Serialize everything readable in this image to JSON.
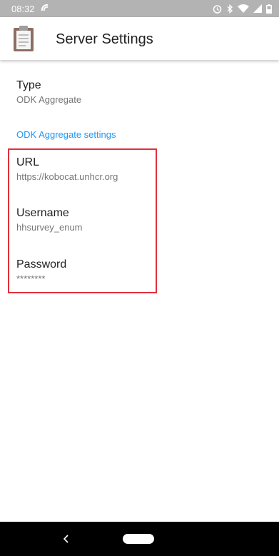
{
  "status_bar": {
    "time": "08:32"
  },
  "app_bar": {
    "title": "Server Settings"
  },
  "preferences": {
    "type": {
      "title": "Type",
      "summary": "ODK Aggregate"
    },
    "category": "ODK Aggregate settings",
    "url": {
      "title": "URL",
      "summary": "https://kobocat.unhcr.org"
    },
    "username": {
      "title": "Username",
      "summary": "hhsurvey_enum"
    },
    "password": {
      "title": "Password",
      "summary": "********"
    }
  },
  "colors": {
    "accent": "#2196f3",
    "highlight": "#e0303a",
    "status_bar": "#b3b3b3",
    "nav_bar": "#000000"
  },
  "icons": {
    "app": "clipboard-icon",
    "status": [
      "sync-icon",
      "alarm-icon",
      "bluetooth-icon",
      "wifi-icon",
      "signal-icon",
      "battery-icon"
    ],
    "nav": [
      "back-icon",
      "home-icon"
    ]
  }
}
